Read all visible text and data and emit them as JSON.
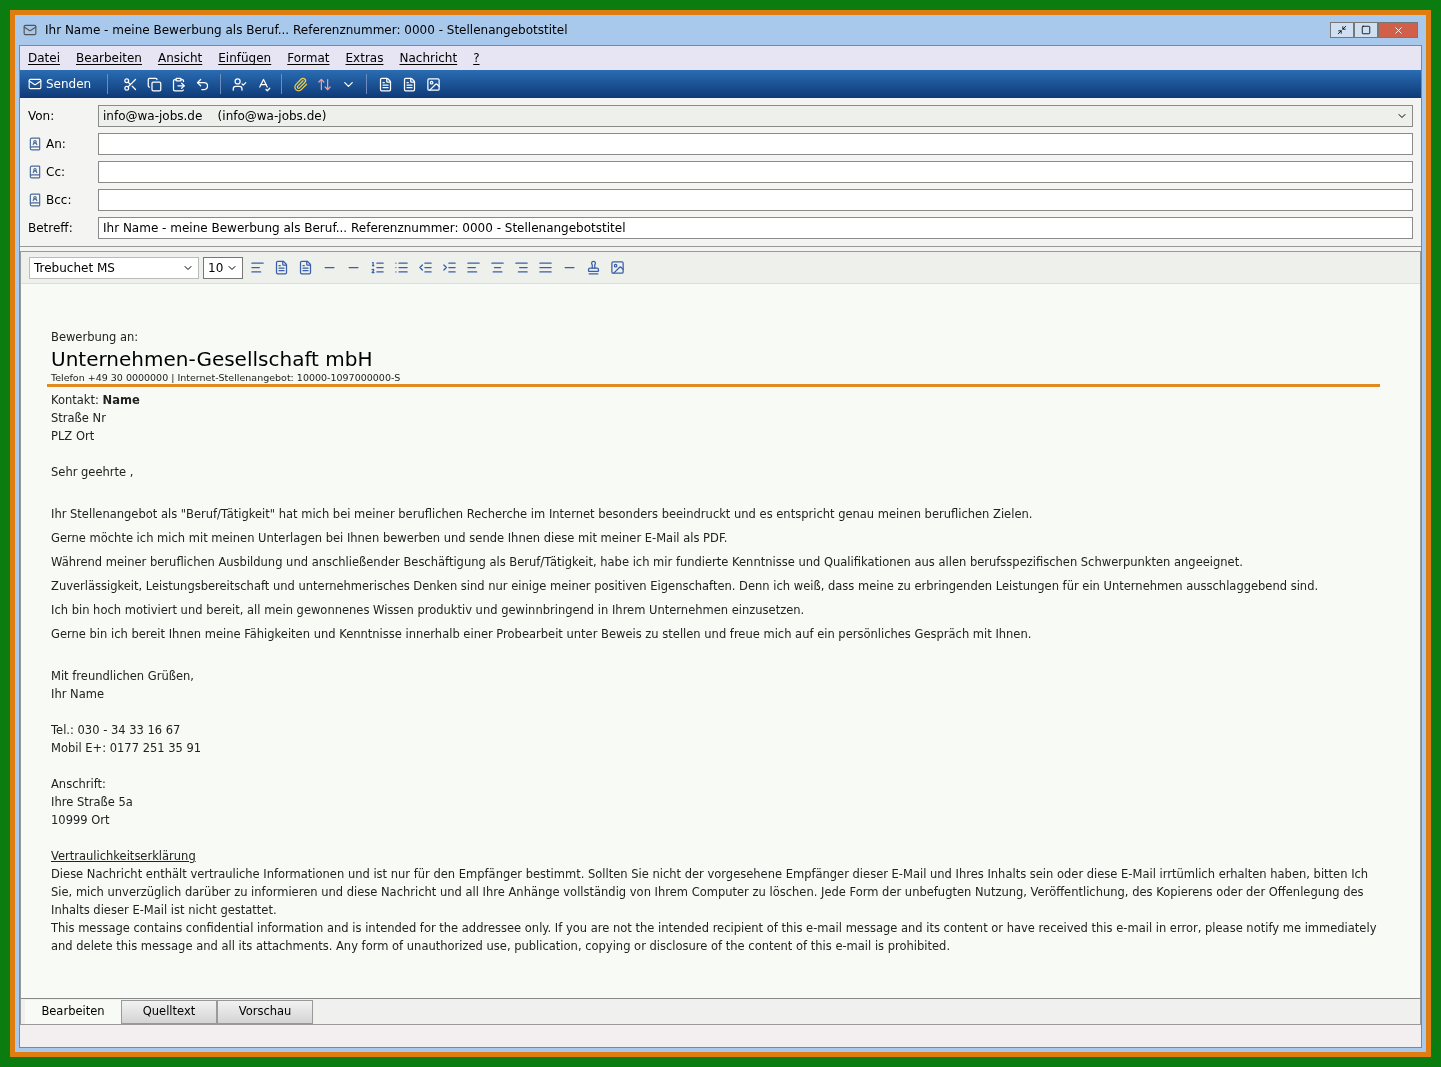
{
  "window": {
    "title": "Ihr Name - meine Bewerbung als Beruf... Referenznummer: 0000 - Stellenangebotstitel"
  },
  "menu": [
    "Datei",
    "Bearbeiten",
    "Ansicht",
    "Einfügen",
    "Format",
    "Extras",
    "Nachricht",
    "?"
  ],
  "toolbar": {
    "send_label": "Senden"
  },
  "header_fields": [
    {
      "kind": "select",
      "label": "Von:",
      "value": "info@wa-jobs.de    (info@wa-jobs.de)"
    },
    {
      "kind": "address",
      "label": "An:"
    },
    {
      "kind": "address",
      "label": "Cc:"
    },
    {
      "kind": "address",
      "label": "Bcc:"
    },
    {
      "kind": "text",
      "label": "Betreff:",
      "value": "Ihr Name - meine Bewerbung als Beruf... Referenznummer: 0000 - Stellenangebotstitel"
    }
  ],
  "format_bar": {
    "font": "Trebuchet MS",
    "size": "10"
  },
  "letter": {
    "recipient_label": "Bewerbung an:",
    "company": "Unternehmen-Gesellschaft mbH",
    "company_info": "Telefon +49 30 0000000 | Internet-Stellenangebot: 10000-1097000000-S",
    "contact": [
      "Kontakt: **Name**",
      "Straße Nr",
      "PLZ Ort"
    ],
    "salutation": "Sehr geehrte ,",
    "paragraphs": [
      "Ihr Stellenangebot als \"Beruf/Tätigkeit\" hat mich bei meiner beruflichen Recherche im Internet besonders beeindruckt und es entspricht genau meinen beruflichen Zielen.",
      "Gerne möchte ich mich mit meinen Unterlagen bei Ihnen bewerben und sende Ihnen diese mit meiner E-Mail als PDF.",
      "Während meiner beruflichen Ausbildung und anschließender Beschäftigung als Beruf/Tätigkeit, habe ich mir fundierte Kenntnisse und Qualifikationen aus allen berufsspezifischen Schwerpunkten angeeignet.",
      "Zuverlässigkeit, Leistungsbereitschaft und unternehmerisches Denken sind nur einige meiner positiven Eigenschaften. Denn ich weiß, dass meine zu erbringenden Leistungen für ein Unternehmen ausschlaggebend sind.",
      "Ich bin hoch motiviert und bereit, all mein gewonnenes Wissen produktiv und gewinnbringend in Ihrem Unternehmen einzusetzen.",
      "Gerne bin ich bereit Ihnen meine Fähigkeiten und Kenntnisse innerhalb einer Probearbeit unter Beweis zu stellen und freue mich auf ein persönliches Gespräch mit Ihnen."
    ],
    "closing": [
      "Mit freundlichen Grüßen,",
      "Ihr Name"
    ],
    "phones": [
      "Tel.: 030 - 34 33 16 67",
      "Mobil E+: 0177 251 35 91"
    ],
    "address": [
      "Anschrift:",
      "Ihre Straße 5a",
      "10999 Ort"
    ],
    "disclaimer_title": "Vertraulichkeitserklärung",
    "disclaimer": [
      "Diese Nachricht enthält vertrauliche Informationen und ist nur für den Empfänger bestimmt. Sollten Sie nicht der vorgesehene Empfänger dieser E-Mail und Ihres Inhalts sein oder diese E-Mail irrtümlich erhalten haben, bitten Ich Sie, mich unverzüglich darüber zu informieren und diese Nachricht und all Ihre Anhänge vollständig von Ihrem Computer zu löschen. Jede Form der unbefugten Nutzung, Veröffentlichung, des Kopierens oder der Offenlegung des Inhalts dieser E-Mail ist nicht gestattet.",
      "This message contains confidential information and is intended for the addressee only. If you are not the intended recipient of this e-mail message and its content or have received this e-mail in error, please notify me immediately and delete this message and all its attachments. Any form of unauthorized use, publication, copying or disclosure of the content of this e-mail is prohibited."
    ]
  },
  "view_tabs": [
    {
      "label": "Bearbeiten",
      "selected": true
    },
    {
      "label": "Quelltext",
      "selected": false
    },
    {
      "label": "Vorschau",
      "selected": false
    }
  ]
}
